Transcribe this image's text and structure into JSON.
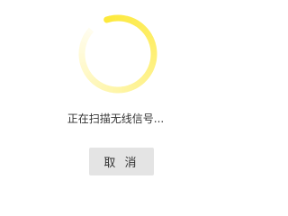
{
  "spinner": {
    "icon": "loading-spinner-icon",
    "accent_color": "#fde93c",
    "fade_color": "#fffdf0"
  },
  "status": {
    "text": "正在扫描无线信号..."
  },
  "actions": {
    "cancel_label": "取 消"
  }
}
